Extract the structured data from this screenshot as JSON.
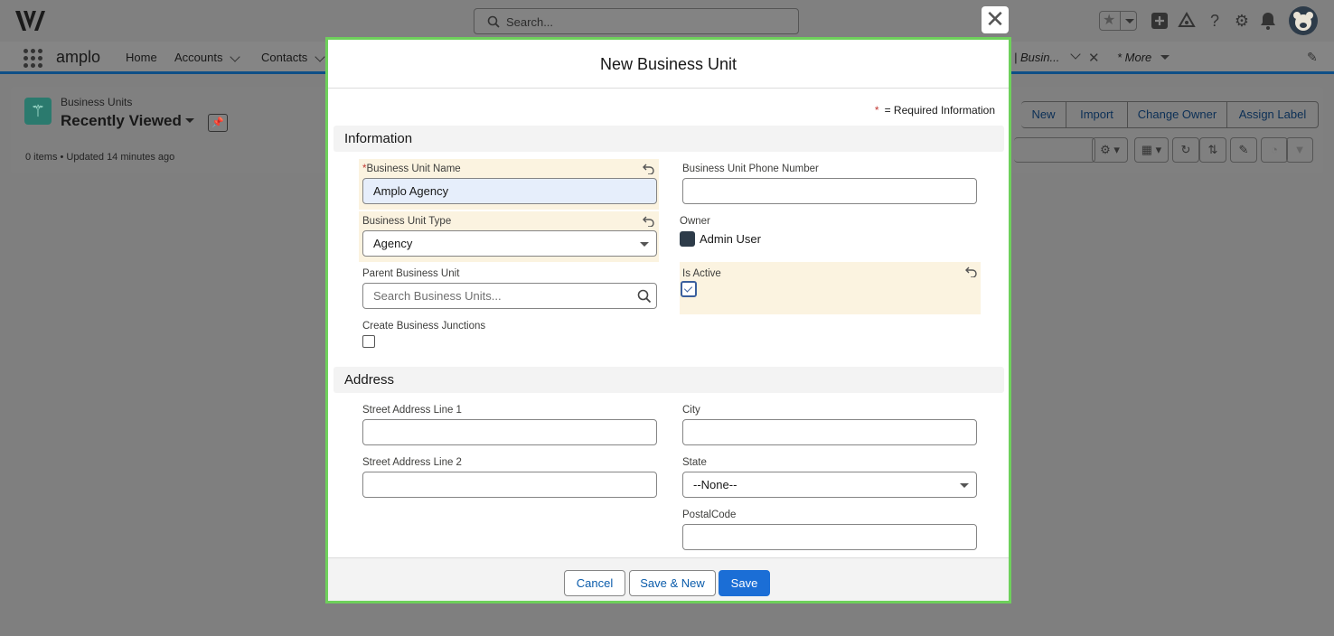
{
  "header": {
    "search_placeholder": "Search...",
    "icons": [
      "favorites-star-icon",
      "add-icon",
      "trailhead-icon",
      "help-icon",
      "setup-gear-icon",
      "notifications-bell-icon",
      "user-avatar"
    ]
  },
  "nav": {
    "app_name": "amplo",
    "items": [
      "Home",
      "Accounts",
      "Contacts"
    ],
    "open_tab": "| Busin...",
    "more": "* More"
  },
  "list": {
    "object_label": "Business Units",
    "view_name": "Recently Viewed",
    "meta": "0 items • Updated 14 minutes ago",
    "buttons": [
      "New",
      "Import",
      "Change Owner",
      "Assign Label"
    ]
  },
  "modal": {
    "title": "New Business Unit",
    "required_note": "= Required Information",
    "required_star": "*",
    "sections": {
      "information": "Information",
      "address": "Address"
    },
    "fields": {
      "bu_name_label": "Business Unit Name",
      "bu_name_value": "Amplo Agency",
      "bu_phone_label": "Business Unit Phone Number",
      "bu_type_label": "Business Unit Type",
      "bu_type_value": "Agency",
      "owner_label": "Owner",
      "owner_value": "Admin User",
      "parent_label": "Parent Business Unit",
      "parent_placeholder": "Search Business Units...",
      "is_active_label": "Is Active",
      "is_active_checked": true,
      "junctions_label": "Create Business Junctions",
      "junctions_checked": false,
      "street1_label": "Street Address Line 1",
      "city_label": "City",
      "street2_label": "Street Address Line 2",
      "state_label": "State",
      "state_value": "--None--",
      "postal_label": "PostalCode"
    },
    "buttons": {
      "cancel": "Cancel",
      "save_new": "Save & New",
      "save": "Save"
    }
  },
  "colors": {
    "highlight_border": "#6ed05b",
    "changed_field_bg": "#fbf3e0",
    "brand_button": "#1b6ed6"
  }
}
